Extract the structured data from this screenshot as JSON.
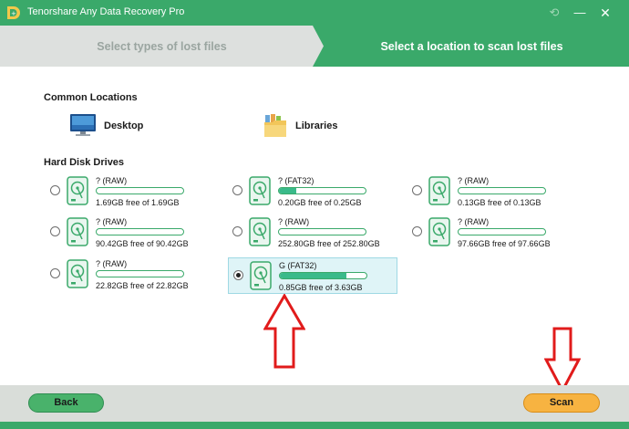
{
  "app": {
    "title": "Tenorshare Any Data Recovery Pro",
    "accent_color": "#3aa96a",
    "titlebar_icons": {
      "history": "history-icon",
      "minimize": "minimize-icon",
      "close": "close-icon"
    },
    "minimize_glyph": "—",
    "close_glyph": "✕"
  },
  "steps": [
    {
      "label": "Select types of lost files",
      "active": false
    },
    {
      "label": "Select a location to scan lost files",
      "active": true
    }
  ],
  "common_locations": {
    "title": "Common Locations",
    "items": [
      {
        "label": "Desktop",
        "icon": "desktop-icon"
      },
      {
        "label": "Libraries",
        "icon": "libraries-folder-icon"
      }
    ]
  },
  "hard_disk_drives": {
    "title": "Hard Disk Drives",
    "drives": [
      {
        "name": "? (RAW)",
        "free_text": "1.69GB free of 1.69GB",
        "used_fraction": 0.0,
        "selected": false
      },
      {
        "name": "? (FAT32)",
        "free_text": "0.20GB free of 0.25GB",
        "used_fraction": 0.2,
        "selected": false
      },
      {
        "name": "? (RAW)",
        "free_text": "0.13GB free of 0.13GB",
        "used_fraction": 0.0,
        "selected": false
      },
      {
        "name": "? (RAW)",
        "free_text": "90.42GB free of 90.42GB",
        "used_fraction": 0.0,
        "selected": false
      },
      {
        "name": "? (RAW)",
        "free_text": "252.80GB free of 252.80GB",
        "used_fraction": 0.0,
        "selected": false
      },
      {
        "name": "? (RAW)",
        "free_text": "97.66GB free of 97.66GB",
        "used_fraction": 0.0,
        "selected": false
      },
      {
        "name": "? (RAW)",
        "free_text": "22.82GB free of 22.82GB",
        "used_fraction": 0.0,
        "selected": false
      },
      {
        "name": "G (FAT32)",
        "free_text": "0.85GB free of 3.63GB",
        "used_fraction": 0.77,
        "selected": true
      }
    ]
  },
  "footer": {
    "back_label": "Back",
    "scan_label": "Scan"
  }
}
